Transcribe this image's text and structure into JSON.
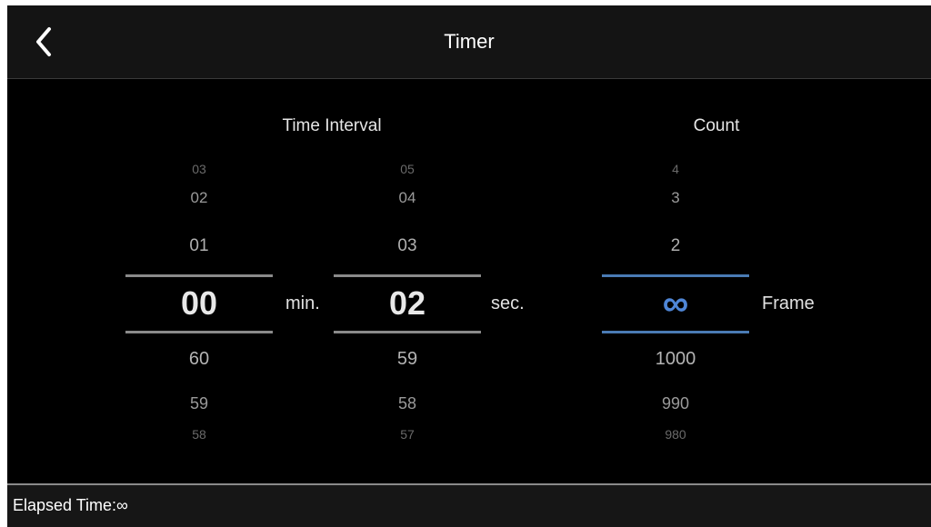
{
  "header": {
    "title": "Timer",
    "back_icon": "chevron-left-icon"
  },
  "time_interval": {
    "label": "Time Interval",
    "minutes": {
      "items_above": [
        "03",
        "02",
        "01"
      ],
      "selected": "00",
      "items_below": [
        "60",
        "59",
        "58"
      ],
      "unit": "min."
    },
    "seconds": {
      "items_above": [
        "05",
        "04",
        "03"
      ],
      "selected": "02",
      "items_below": [
        "59",
        "58",
        "57"
      ],
      "unit": "sec."
    }
  },
  "count": {
    "label": "Count",
    "items_above": [
      "4",
      "3",
      "2"
    ],
    "selected": "∞",
    "items_below": [
      "1000",
      "990",
      "980"
    ],
    "unit": "Frame"
  },
  "footer": {
    "elapsed": "Elapsed Time:∞"
  },
  "colors": {
    "background": "#000000",
    "header": "#141414",
    "accent_blue": "#4f86d6",
    "divider": "#8a8a8a",
    "text": "#ffffff"
  }
}
